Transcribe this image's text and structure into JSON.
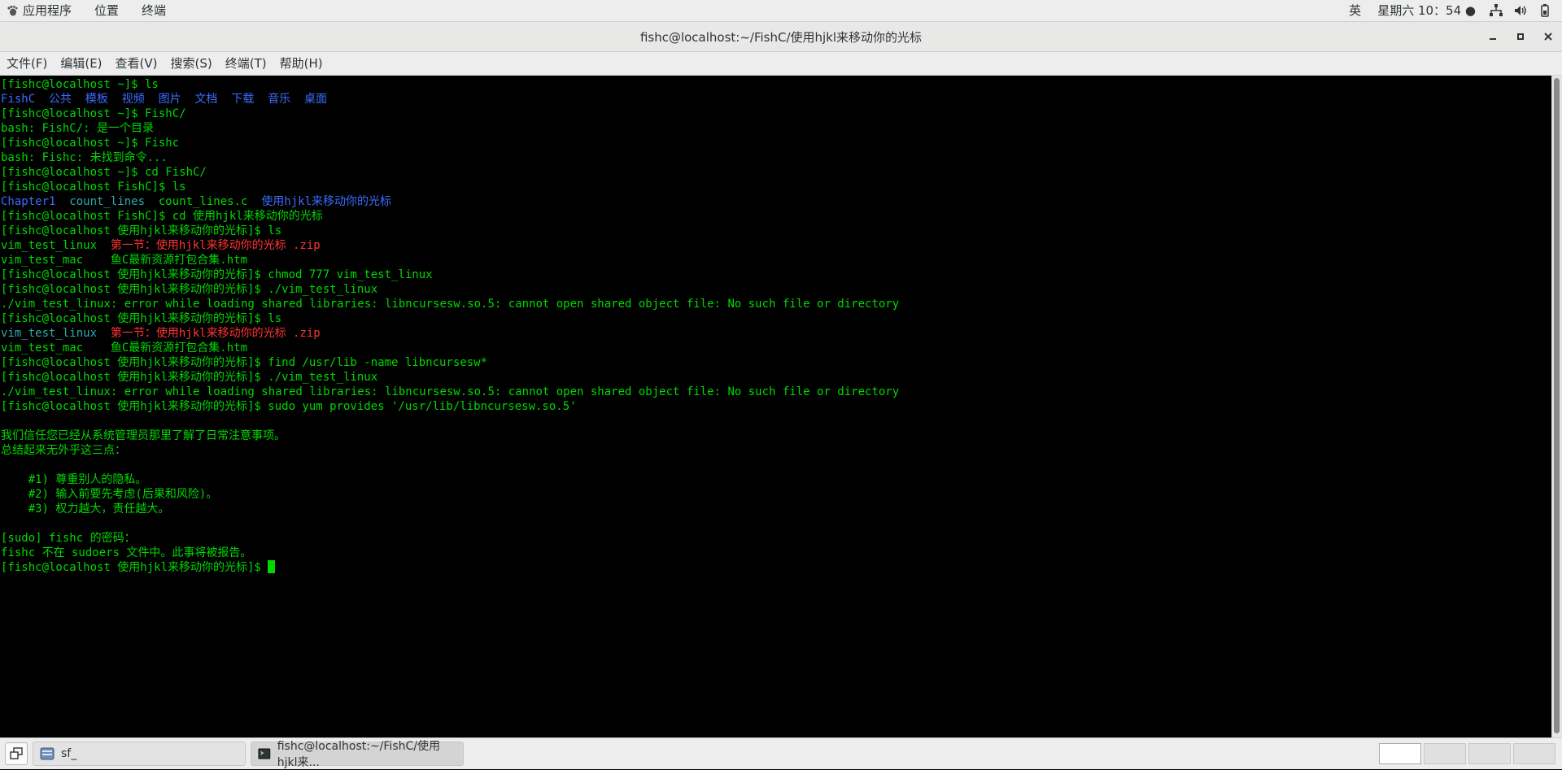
{
  "top_panel": {
    "applications": "应用程序",
    "places": "位置",
    "terminal_app": "终端",
    "input_method": "英",
    "clock": "星期六 10：54 ●"
  },
  "window": {
    "title": "fishc@localhost:~/FishC/使用hjkl来移动你的光标"
  },
  "menu": {
    "file": "文件(F)",
    "edit": "编辑(E)",
    "view": "查看(V)",
    "search": "搜索(S)",
    "terminal": "终端(T)",
    "help": "帮助(H)"
  },
  "terminal_lines": [
    [
      {
        "t": "[fishc@localhost ~]$ ls",
        "c": "green"
      }
    ],
    [
      {
        "t": "FishC  公共  模板  视频  图片  文档  下载  音乐  桌面",
        "c": "blue"
      }
    ],
    [
      {
        "t": "[fishc@localhost ~]$ FishC/",
        "c": "green"
      }
    ],
    [
      {
        "t": "bash: FishC/: 是一个目录",
        "c": "green"
      }
    ],
    [
      {
        "t": "[fishc@localhost ~]$ Fishc",
        "c": "green"
      }
    ],
    [
      {
        "t": "bash: Fishc: 未找到命令...",
        "c": "green"
      }
    ],
    [
      {
        "t": "[fishc@localhost ~]$ cd FishC/",
        "c": "green"
      }
    ],
    [
      {
        "t": "[fishc@localhost FishC]$ ls",
        "c": "green"
      }
    ],
    [
      {
        "t": "Chapter1",
        "c": "blue"
      },
      {
        "t": "  ",
        "c": "green"
      },
      {
        "t": "count_lines",
        "c": "cyan"
      },
      {
        "t": "  count_lines.c  ",
        "c": "green"
      },
      {
        "t": "使用hjkl来移动你的光标",
        "c": "blue"
      }
    ],
    [
      {
        "t": "[fishc@localhost FishC]$ cd 使用hjkl来移动你的光标",
        "c": "green"
      }
    ],
    [
      {
        "t": "[fishc@localhost 使用hjkl来移动你的光标]$ ls",
        "c": "green"
      }
    ],
    [
      {
        "t": "vim_test_linux  ",
        "c": "green"
      },
      {
        "t": "第一节：使用hjkl来移动你的光标 .zip",
        "c": "red"
      }
    ],
    [
      {
        "t": "vim_test_mac    鱼C最新资源打包合集.htm",
        "c": "green"
      }
    ],
    [
      {
        "t": "[fishc@localhost 使用hjkl来移动你的光标]$ chmod 777 vim_test_linux",
        "c": "green"
      }
    ],
    [
      {
        "t": "[fishc@localhost 使用hjkl来移动你的光标]$ ./vim_test_linux",
        "c": "green"
      }
    ],
    [
      {
        "t": "./vim_test_linux: error while loading shared libraries: libncursesw.so.5: cannot open shared object file: No such file or directory",
        "c": "green"
      }
    ],
    [
      {
        "t": "[fishc@localhost 使用hjkl来移动你的光标]$ ls",
        "c": "green"
      }
    ],
    [
      {
        "t": "vim_test_linux",
        "c": "cyan"
      },
      {
        "t": "  ",
        "c": "green"
      },
      {
        "t": "第一节：使用hjkl来移动你的光标 .zip",
        "c": "red"
      }
    ],
    [
      {
        "t": "vim_test_mac    鱼C最新资源打包合集.htm",
        "c": "green"
      }
    ],
    [
      {
        "t": "[fishc@localhost 使用hjkl来移动你的光标]$ find /usr/lib -name libncursesw*",
        "c": "green"
      }
    ],
    [
      {
        "t": "[fishc@localhost 使用hjkl来移动你的光标]$ ./vim_test_linux",
        "c": "green"
      }
    ],
    [
      {
        "t": "./vim_test_linux: error while loading shared libraries: libncursesw.so.5: cannot open shared object file: No such file or directory",
        "c": "green"
      }
    ],
    [
      {
        "t": "[fishc@localhost 使用hjkl来移动你的光标]$ sudo yum provides '/usr/lib/libncursesw.so.5'",
        "c": "green"
      }
    ],
    [
      {
        "t": "",
        "c": "green"
      }
    ],
    [
      {
        "t": "我们信任您已经从系统管理员那里了解了日常注意事项。",
        "c": "green"
      }
    ],
    [
      {
        "t": "总结起来无外乎这三点：",
        "c": "green"
      }
    ],
    [
      {
        "t": "",
        "c": "green"
      }
    ],
    [
      {
        "t": "    #1) 尊重别人的隐私。",
        "c": "green"
      }
    ],
    [
      {
        "t": "    #2) 输入前要先考虑(后果和风险)。",
        "c": "green"
      }
    ],
    [
      {
        "t": "    #3) 权力越大，责任越大。",
        "c": "green"
      }
    ],
    [
      {
        "t": "",
        "c": "green"
      }
    ],
    [
      {
        "t": "[sudo] fishc 的密码：",
        "c": "green"
      }
    ],
    [
      {
        "t": "fishc 不在 sudoers 文件中。此事将被报告。",
        "c": "green"
      }
    ],
    [
      {
        "t": "[fishc@localhost 使用hjkl来移动你的光标]$ ",
        "c": "green"
      }
    ]
  ],
  "taskbar": {
    "task_files": "sf_",
    "task_terminal": "fishc@localhost:~/FishC/使用hjkl来..."
  },
  "colors": {
    "green": "#00d800",
    "blue": "#3c6cff",
    "cyan": "#2fa9a9",
    "red": "#ff3333"
  }
}
